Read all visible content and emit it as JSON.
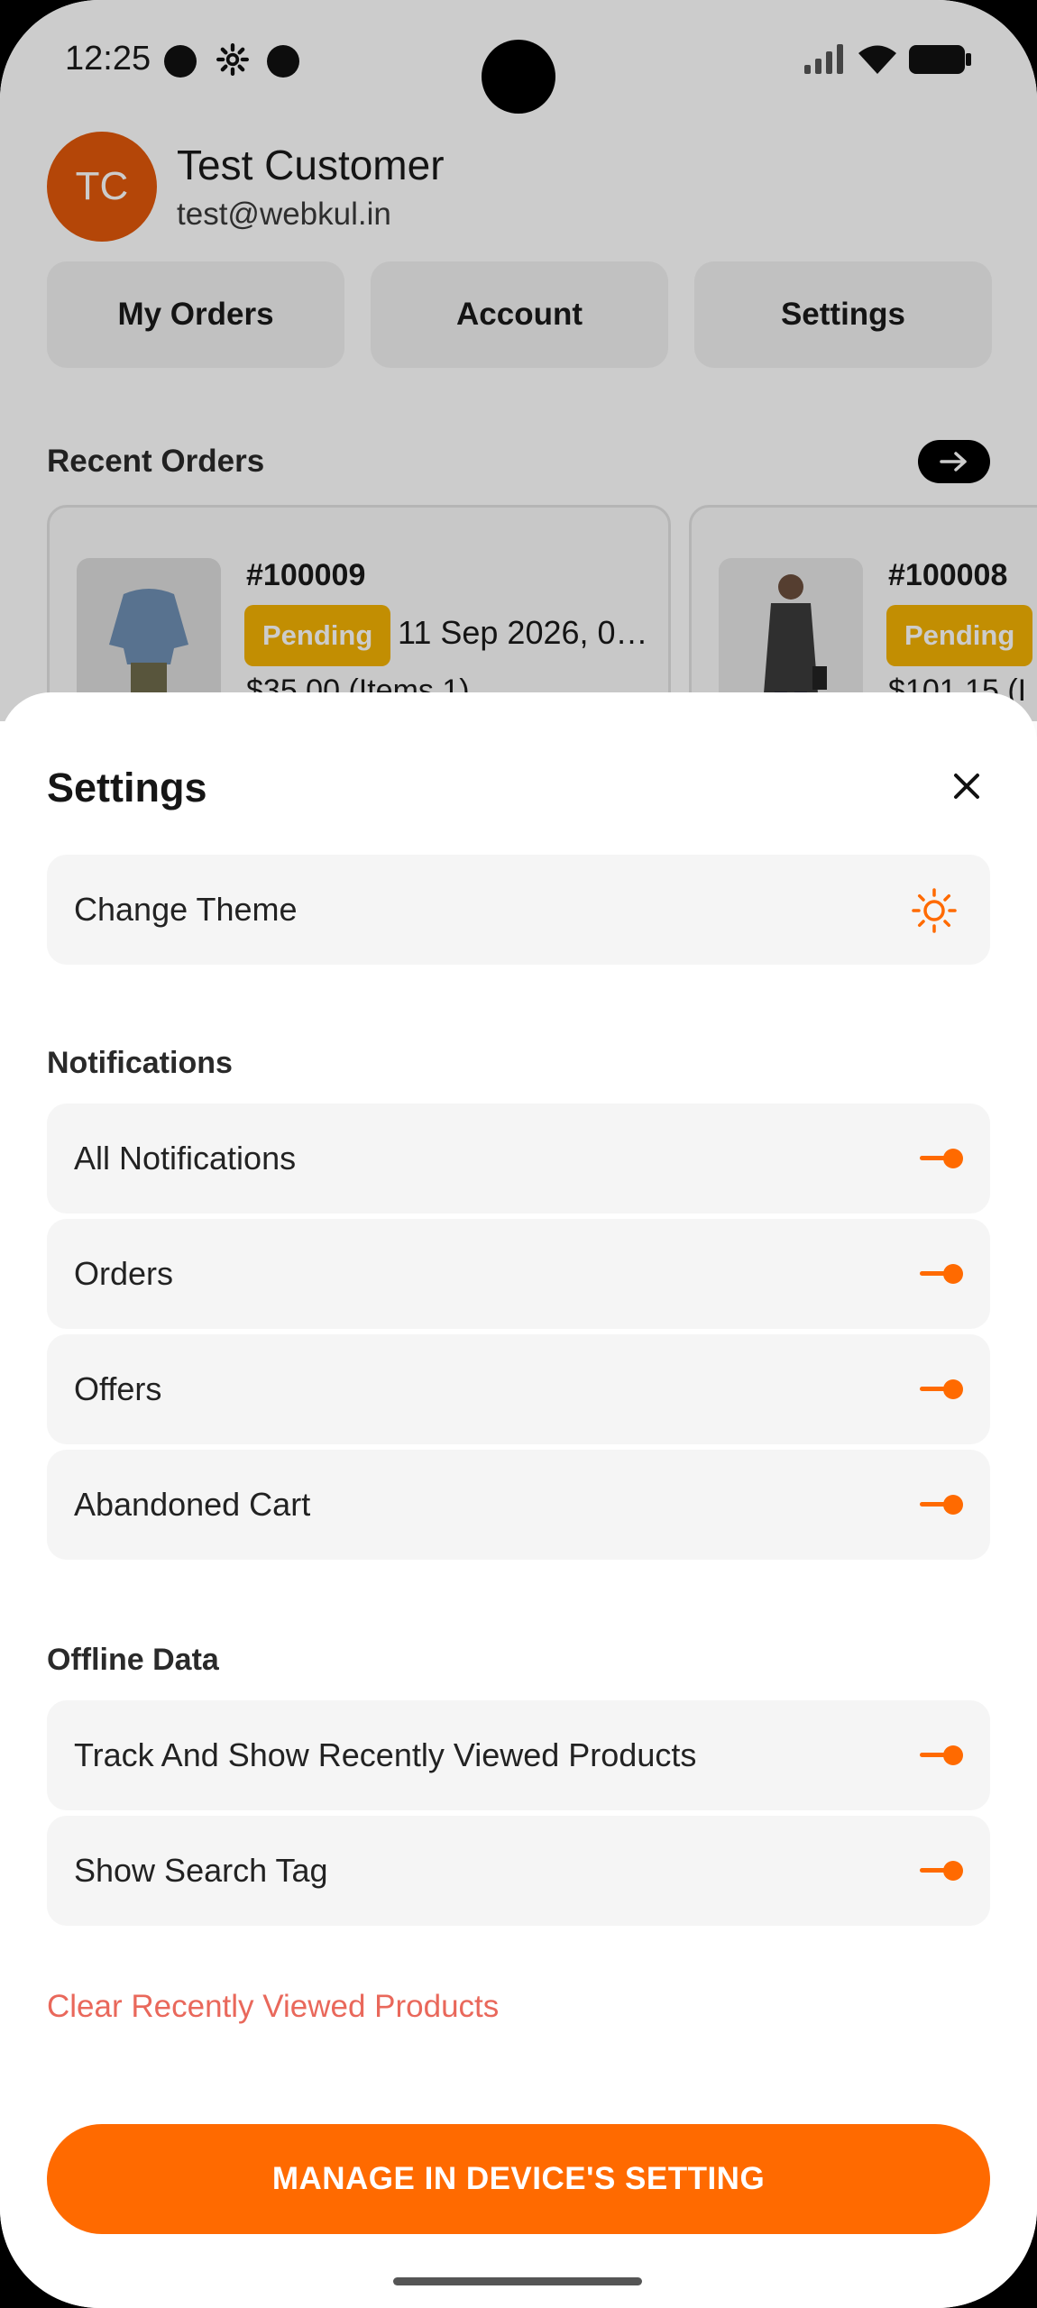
{
  "status_bar": {
    "time": "12:25"
  },
  "profile": {
    "initials": "TC",
    "name": "Test Customer",
    "email": "test@webkul.in"
  },
  "quick_actions": [
    {
      "label": "My Orders"
    },
    {
      "label": "Account"
    },
    {
      "label": "Settings"
    }
  ],
  "recent_orders": {
    "title": "Recent Orders",
    "orders": [
      {
        "id": "#100009",
        "status": "Pending",
        "date": "11 Sep 2026, 0…",
        "total": "$35.00 (Items 1)"
      },
      {
        "id": "#100008",
        "status": "Pending",
        "date": "",
        "total": "$101.15 (I"
      }
    ]
  },
  "settings_sheet": {
    "title": "Settings",
    "theme": {
      "label": "Change Theme",
      "icon": "sun-icon"
    },
    "notifications": {
      "title": "Notifications",
      "items": [
        {
          "label": "All Notifications",
          "enabled": true
        },
        {
          "label": "Orders",
          "enabled": true
        },
        {
          "label": "Offers",
          "enabled": true
        },
        {
          "label": "Abandoned Cart",
          "enabled": true
        }
      ]
    },
    "offline_data": {
      "title": "Offline Data",
      "items": [
        {
          "label": "Track And Show Recently Viewed Products",
          "enabled": true
        },
        {
          "label": "Show Search Tag",
          "enabled": true
        }
      ]
    },
    "clear_link": "Clear Recently Viewed Products",
    "manage_button": "MANAGE IN DEVICE'S SETTING"
  },
  "colors": {
    "accent": "#ff6a00",
    "badge": "#f3b203",
    "avatar": "#e2580a",
    "link": "#e9685b"
  }
}
